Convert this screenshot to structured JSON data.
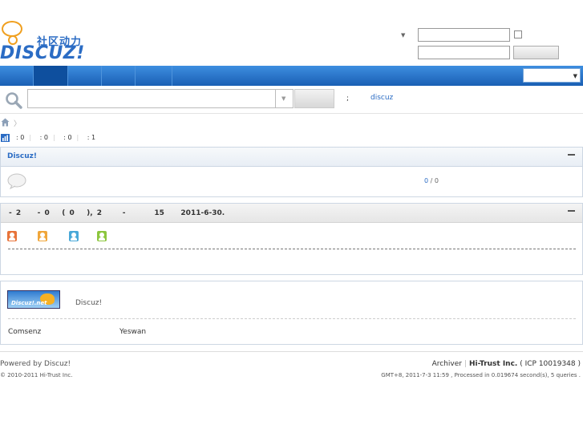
{
  "header": {
    "logo_cn": "社区动力",
    "logo_word": "DISCUZ!"
  },
  "search": {
    "hot_colon": ";",
    "hot_keyword": "discuz"
  },
  "stats": [
    "0",
    "0",
    "0",
    "1"
  ],
  "forum": {
    "title": "Discuz!",
    "count_today": "0",
    "count_total": "0"
  },
  "online": {
    "summary": "- 2    - 0   ( 0   ), 2     -       15    2011-6-30."
  },
  "links": {
    "logo_text": "Discuz!.net",
    "site_name": "Discuz!",
    "items": [
      "Comsenz",
      "Yeswan"
    ]
  },
  "footer": {
    "powered": "Powered by Discuz!",
    "copyright": "© 2010-2011 Hi-Trust Inc.",
    "archiver": "Archiver",
    "company": "Hi-Trust Inc.",
    "icp": "( ICP 10019348 )",
    "time": "GMT+8, 2011-7-3 11:59 , Processed in 0.019674 second(s), 5 queries ."
  },
  "colors": {
    "nav": "#1a5fb4",
    "link": "#2b6cc4",
    "logo_accent": "#f0a020"
  }
}
